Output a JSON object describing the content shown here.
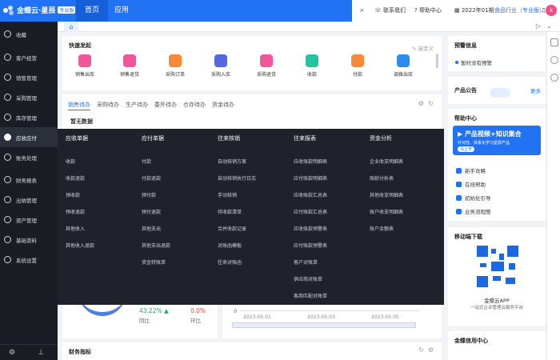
{
  "header": {
    "brand": "金蝶云·星辰",
    "edition_badge": "专业版",
    "tabs": [
      {
        "label": "首页"
      },
      {
        "label": "应用"
      }
    ],
    "contact": "联系我们",
    "help": "帮助中心",
    "period": "2022年01期",
    "industry": "食品行业（专业版）",
    "avatar_letter": "k",
    "accent": "#2273f3"
  },
  "sidebar": {
    "items": [
      {
        "label": "收藏",
        "icon": "star-icon"
      },
      {
        "label": "客户经营",
        "icon": "users-icon"
      },
      {
        "label": "销售管理",
        "icon": "sales-icon"
      },
      {
        "label": "采购管理",
        "icon": "cart-icon"
      },
      {
        "label": "库存管理",
        "icon": "box-icon"
      },
      {
        "label": "应收应付",
        "icon": "yen-icon"
      },
      {
        "label": "账务处理",
        "icon": "ledger-icon"
      },
      {
        "label": "财务报表",
        "icon": "report-icon"
      },
      {
        "label": "出纳管理",
        "icon": "cashier-icon"
      },
      {
        "label": "资产管理",
        "icon": "asset-icon"
      },
      {
        "label": "基础资料",
        "icon": "database-icon"
      },
      {
        "label": "系统设置",
        "icon": "gear-icon"
      }
    ],
    "highlighted": "应收应付"
  },
  "quick_launch": {
    "title": "快速发起",
    "customize": "自定义",
    "items": [
      {
        "label": "销售出库",
        "color": "#f0579b"
      },
      {
        "label": "销售退货",
        "color": "#f0579b"
      },
      {
        "label": "采购订单",
        "color": "#f68a3a"
      },
      {
        "label": "采购入库",
        "color": "#5567e0"
      },
      {
        "label": "采购退货",
        "color": "#f0579b"
      },
      {
        "label": "收款",
        "color": "#26c1a0"
      },
      {
        "label": "付款",
        "color": "#f68a3a"
      },
      {
        "label": "调拨出库",
        "color": "#2d8cf0"
      }
    ]
  },
  "todo": {
    "tabs": [
      "销售待办",
      "采购待办",
      "生产待办",
      "委外待办",
      "仓存待办",
      "资金待办"
    ],
    "empty": "暂无数据"
  },
  "mega_menu": {
    "columns": [
      {
        "title": "应收单据",
        "items": [
          "收款",
          "收款退款",
          "预收款",
          "预收退款",
          "其他收入",
          "其他收入退款"
        ]
      },
      {
        "title": "应付单据",
        "items": [
          "付款",
          "付款退款",
          "预付款",
          "预付退款",
          "其他支出",
          "其他支出退款",
          "资金转账单"
        ]
      },
      {
        "title": "往来核销",
        "items": [
          "自动核销方案",
          "自动核销执行日志",
          "手动核销",
          "待收款清单",
          "合并收款记录",
          "对账函模板",
          "往来对账函"
        ]
      },
      {
        "title": "往来报表",
        "items": [
          "应收账款明细表",
          "应付账款明细表",
          "应收账款汇总表",
          "应付账款汇总表",
          "应收账款预警表",
          "应付账款预警表",
          "客户对账单",
          "供应商对账单",
          "客商匹配对账单"
        ]
      },
      {
        "title": "资金分析",
        "items": [
          "企业收支明细表",
          "账龄分析表",
          "其他收支明细表",
          "账户收支明细表",
          "账户余额表"
        ]
      }
    ]
  },
  "stats": {
    "growth": "43.22%",
    "growth_label": "同比",
    "ratio": "0.0%",
    "ratio_label": "环比"
  },
  "trend_chart": {
    "y_zero": "0",
    "dates": [
      "2023-05-01",
      "2023-05-03",
      "2023-05-05"
    ]
  },
  "finance": {
    "title": "财务指标"
  },
  "alerts": {
    "title": "预警信息",
    "empty": "暂时没有预警"
  },
  "notice": {
    "title": "产品公告",
    "more": "更多"
  },
  "help_center": {
    "title": "帮助中心",
    "banner_title": "产品视频+知识集合",
    "banner_sub": "针对性、体系化学习星辰产品",
    "banner_button": "马上学",
    "items": [
      "新手攻略",
      "在线帮助",
      "初始化引导",
      "业务流程图"
    ]
  },
  "mobile": {
    "title": "移动端下载",
    "app_name": "金蝶云APP",
    "desc": "一站式企业管理云服务平台"
  },
  "credit": {
    "title": "金蝶信用中心"
  }
}
